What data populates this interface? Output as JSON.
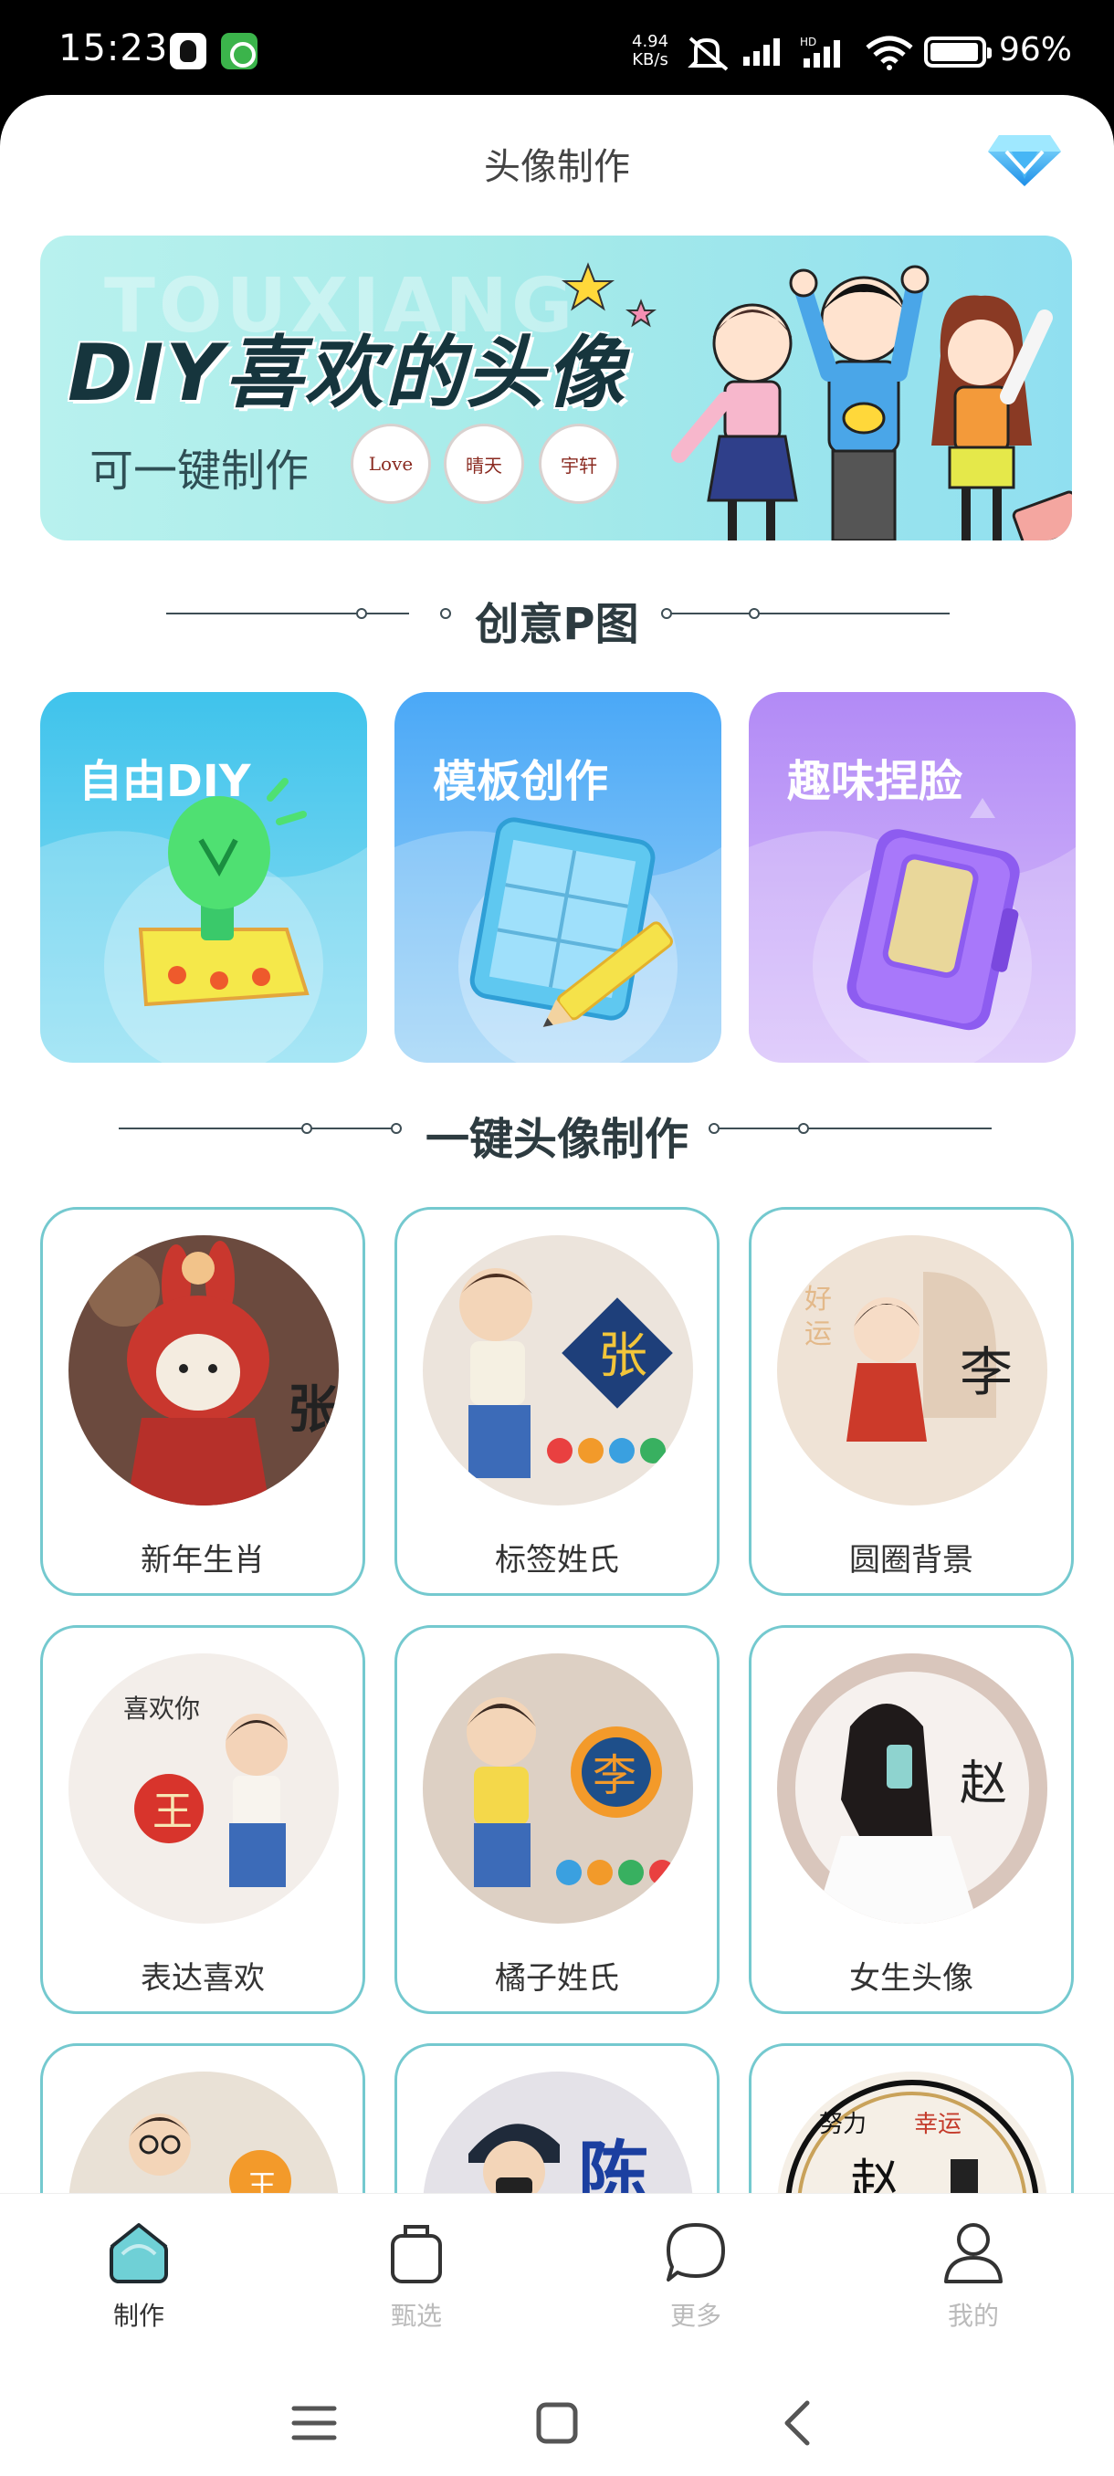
{
  "status_bar": {
    "time": "15:23",
    "net_speed_value": "4.94",
    "net_speed_unit": "KB/s",
    "battery": "96%"
  },
  "header": {
    "title": "头像制作",
    "vip_icon": "diamond-icon"
  },
  "banner": {
    "bg_text": "TOUXIANG",
    "title": "DIY喜欢的头像",
    "subtitle": "可一键制作",
    "badges": [
      "Love",
      "晴天",
      "宇轩"
    ]
  },
  "sections": {
    "creative": "创意P图",
    "one_click": "一键头像制作"
  },
  "feature_cards": [
    {
      "label": "自由DIY",
      "icon": "lightbulb-icon"
    },
    {
      "label": "模板创作",
      "icon": "template-pencil-icon"
    },
    {
      "label": "趣味捏脸",
      "icon": "phone-book-icon"
    }
  ],
  "avatar_tiles": [
    {
      "label": "新年生肖",
      "char": "张"
    },
    {
      "label": "标签姓氏",
      "char": "张"
    },
    {
      "label": "圆圈背景",
      "char": "李"
    },
    {
      "label": "表达喜欢",
      "char": "王"
    },
    {
      "label": "橘子姓氏",
      "char": "李"
    },
    {
      "label": "女生头像",
      "char": "赵"
    },
    {
      "label": "",
      "char": "王"
    },
    {
      "label": "",
      "char": "陈"
    },
    {
      "label": "",
      "char": "赵"
    }
  ],
  "tabbar": {
    "tabs": [
      {
        "label": "制作",
        "icon": "home-icon",
        "active": true
      },
      {
        "label": "甄选",
        "icon": "bag-icon",
        "active": false
      },
      {
        "label": "更多",
        "icon": "chat-bubble-icon",
        "active": false
      },
      {
        "label": "我的",
        "icon": "person-icon",
        "active": false
      }
    ]
  },
  "colors": {
    "accent": "#74c9cf",
    "tab_active": "#333333",
    "tab_inactive": "#bbbbbb"
  }
}
